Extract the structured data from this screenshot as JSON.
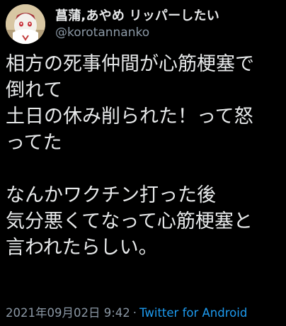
{
  "author": {
    "display_name": "菖蒲,あやめ リッパーしたい",
    "handle": "@korotannanko",
    "avatar_icon": "character-avatar-icon"
  },
  "tweet": {
    "lines": [
      "相方の死事仲間が心筋梗塞で",
      "倒れて",
      "土日の休み削られた！って怒",
      "ってた",
      "",
      "なんかワクチン打った後",
      "気分悪くてなって心筋梗塞と",
      "言われたらしい。"
    ]
  },
  "meta": {
    "timestamp": "2021年09月02日 9:42",
    "separator": "·",
    "source": "Twitter for Android"
  },
  "colors": {
    "background": "#000000",
    "text": "#e7e9ea",
    "secondary": "#8b98a5",
    "accent": "#1d9bf0"
  }
}
